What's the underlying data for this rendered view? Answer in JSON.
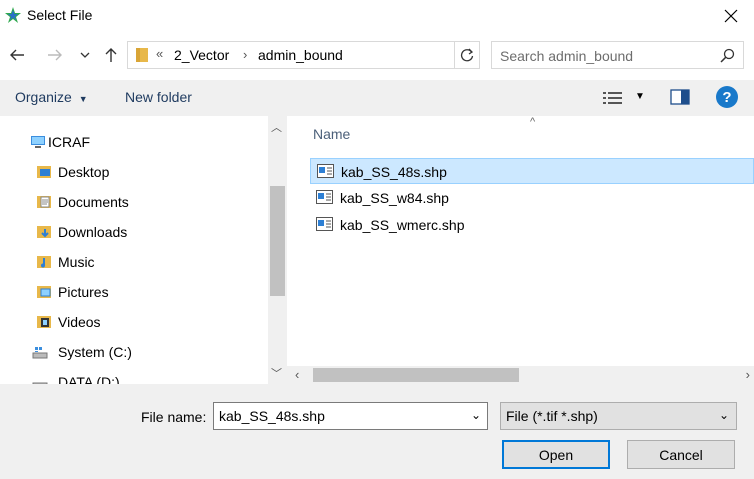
{
  "window": {
    "title": "Select File"
  },
  "address": {
    "overflow": "«",
    "segments": [
      "2_Vector",
      "admin_bound"
    ]
  },
  "search": {
    "placeholder": "Search admin_bound"
  },
  "toolbar": {
    "organize": "Organize",
    "new_folder": "New folder"
  },
  "nav_tree": [
    {
      "label": "ICRAF",
      "icon": "computer-icon"
    },
    {
      "label": "Desktop",
      "icon": "desktop-folder-icon"
    },
    {
      "label": "Documents",
      "icon": "documents-folder-icon"
    },
    {
      "label": "Downloads",
      "icon": "downloads-folder-icon"
    },
    {
      "label": "Music",
      "icon": "music-folder-icon"
    },
    {
      "label": "Pictures",
      "icon": "pictures-folder-icon"
    },
    {
      "label": "Videos",
      "icon": "videos-folder-icon"
    },
    {
      "label": "System (C:)",
      "icon": "drive-icon"
    },
    {
      "label": "DATA (D:)",
      "icon": "drive-icon"
    }
  ],
  "file_list": {
    "column_name": "Name",
    "files": [
      {
        "name": "kab_SS_48s.shp",
        "selected": true
      },
      {
        "name": "kab_SS_w84.shp",
        "selected": false
      },
      {
        "name": "kab_SS_wmerc.shp",
        "selected": false
      }
    ]
  },
  "footer": {
    "file_name_label": "File name:",
    "file_name_value": "kab_SS_48s.shp",
    "file_type": "File (*.tif *.shp)",
    "open_label": "Open",
    "cancel_label": "Cancel"
  },
  "colors": {
    "accent": "#0078d7",
    "selection": "#cce8ff",
    "help": "#1979ca"
  }
}
